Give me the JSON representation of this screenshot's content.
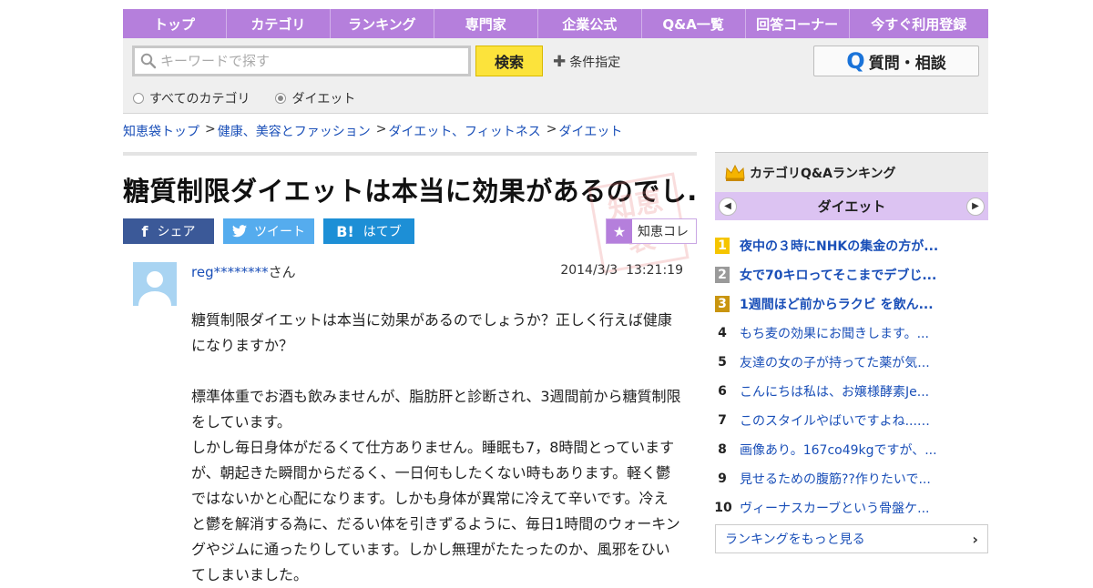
{
  "nav": {
    "items": [
      "トップ",
      "カテゴリ",
      "ランキング",
      "専門家",
      "企業公式",
      "Q&A一覧",
      "回答コーナー",
      "今すぐ利用登録"
    ]
  },
  "search": {
    "placeholder": "キーワードで探す",
    "button": "検索",
    "conditions": "条件指定",
    "ask_button": "質問・相談",
    "radio_all": "すべてのカテゴリ",
    "radio_diet": "ダイエット",
    "selected": "ダイエット"
  },
  "breadcrumb": [
    "知恵袋トップ",
    "健康、美容とファッション",
    "ダイエット、フィットネス",
    "ダイエット"
  ],
  "question": {
    "title": "糖質制限ダイエットは本当に効果があるのでし...",
    "share": {
      "facebook": "シェア",
      "twitter": "ツイート",
      "hatena": "はてブ",
      "collect": "知恵コレ"
    },
    "user_id": "reg********",
    "user_suffix": "さん",
    "date": "2014/3/3",
    "time": "13:21:19",
    "body": {
      "p1_l1": "糖質制限ダイエットは本当に効果があるのでしょうか？正しく行えば健康",
      "p1_l2": "になりますか？",
      "p2_l1": "標準体重でお酒も飲みませんが、脂肪肝と診断され、3週間前から糖質制限",
      "p2_l2": "をしています。",
      "p3_l1": "しかし毎日身体がだるくて仕方ありません。睡眠も7，8時間とっています",
      "p3_l2": "が、朝起きた瞬間からだるく、一日何もしたくない時もあります。軽く鬱",
      "p3_l3": "ではないかと心配になります。しかも身体が異常に冷えて辛いです。冷え",
      "p3_l4": "と鬱を解消する為に、だるい体を引きずるように、毎日1時間のウォーキン",
      "p3_l5": "グやジムに通ったりしています。しかし無理がたたったのか、風邪をひい",
      "p3_l6": "てしまいました。"
    }
  },
  "sidebar": {
    "heading": "カテゴリQ&Aランキング",
    "category": "ダイエット",
    "ranking": [
      {
        "rank": "1",
        "text": "夜中の３時にNHKの集金の方が..."
      },
      {
        "rank": "2",
        "text": "女で70キロってそこまでデブじ..."
      },
      {
        "rank": "3",
        "text": "1週間ほど前からラクビ を飲ん..."
      },
      {
        "rank": "4",
        "text": "もち麦の効果にお聞きします。..."
      },
      {
        "rank": "5",
        "text": "友達の女の子が持ってた薬が気..."
      },
      {
        "rank": "6",
        "text": "こんにちは私は、お嬢様酵素Je..."
      },
      {
        "rank": "7",
        "text": "このスタイルやばいですよね...…"
      },
      {
        "rank": "8",
        "text": "画像あり。167co49kgですが、..."
      },
      {
        "rank": "9",
        "text": "見せるための腹筋??作りたいで..."
      },
      {
        "rank": "10",
        "text": "ヴィーナスカーブという骨盤ケ..."
      }
    ],
    "more": "ランキングをもっと見る"
  },
  "colors": {
    "nav": "#b57fdc",
    "link": "#1a4fb8",
    "search_button": "#fce33b"
  }
}
